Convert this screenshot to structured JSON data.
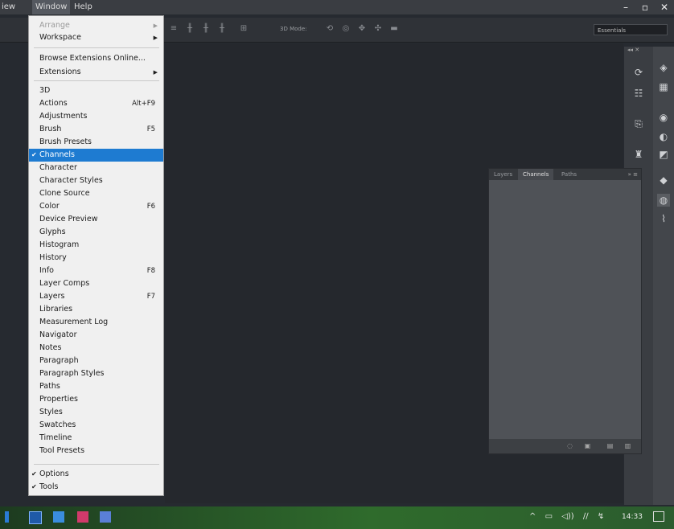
{
  "menubar": {
    "view": "iew",
    "window": "Window",
    "help": "Help"
  },
  "window_controls": {
    "minimize": "–",
    "maximize": "▫",
    "close": "✕"
  },
  "optionsbar": {
    "mode_label": "3D Mode:",
    "workspace": "Essentials"
  },
  "window_menu": {
    "items": [
      {
        "label": "Arrange",
        "arrow": "▶",
        "disabled": true
      },
      {
        "label": "Workspace",
        "arrow": "▶"
      },
      {
        "label": "Browse Extensions Online..."
      },
      {
        "label": "Extensions",
        "arrow": "▶"
      },
      {
        "label": "3D"
      },
      {
        "label": "Actions",
        "shortcut": "Alt+F9"
      },
      {
        "label": "Adjustments"
      },
      {
        "label": "Brush",
        "shortcut": "F5"
      },
      {
        "label": "Brush Presets"
      },
      {
        "label": "Channels",
        "checked": true,
        "selected": true
      },
      {
        "label": "Character"
      },
      {
        "label": "Character Styles"
      },
      {
        "label": "Clone Source"
      },
      {
        "label": "Color",
        "shortcut": "F6"
      },
      {
        "label": "Device Preview"
      },
      {
        "label": "Glyphs"
      },
      {
        "label": "Histogram"
      },
      {
        "label": "History"
      },
      {
        "label": "Info",
        "shortcut": "F8"
      },
      {
        "label": "Layer Comps"
      },
      {
        "label": "Layers",
        "shortcut": "F7"
      },
      {
        "label": "Libraries"
      },
      {
        "label": "Measurement Log"
      },
      {
        "label": "Navigator"
      },
      {
        "label": "Notes"
      },
      {
        "label": "Paragraph"
      },
      {
        "label": "Paragraph Styles"
      },
      {
        "label": "Paths"
      },
      {
        "label": "Properties"
      },
      {
        "label": "Styles"
      },
      {
        "label": "Swatches"
      },
      {
        "label": "Timeline"
      },
      {
        "label": "Tool Presets"
      },
      {
        "label": "Options",
        "checked": true
      },
      {
        "label": "Tools",
        "checked": true
      }
    ]
  },
  "channels_panel": {
    "tabs": [
      "Layers",
      "Channels",
      "Paths"
    ],
    "active_tab": "Channels",
    "menu_glyph": "»  ≡"
  },
  "taskbar": {
    "apps": [
      "photoshop-app",
      "dropbox-app",
      "indesign-app",
      "visio-app"
    ],
    "tray_glyphs": [
      "^",
      "▭",
      "◁))",
      "∕∕",
      "↯"
    ],
    "clock": "14:33"
  },
  "colors": {
    "menu_highlight": "#1e7bd1",
    "app_background": "#262a30",
    "taskbar_green": "#2f6b2c"
  }
}
